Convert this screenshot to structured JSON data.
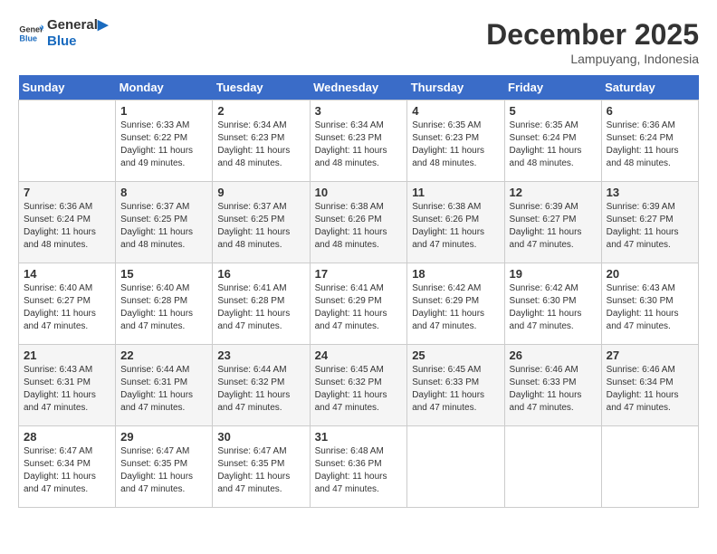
{
  "header": {
    "logo_line1": "General",
    "logo_line2": "Blue",
    "month": "December 2025",
    "location": "Lampuyang, Indonesia"
  },
  "days_of_week": [
    "Sunday",
    "Monday",
    "Tuesday",
    "Wednesday",
    "Thursday",
    "Friday",
    "Saturday"
  ],
  "weeks": [
    [
      {
        "day": "",
        "info": ""
      },
      {
        "day": "1",
        "info": "Sunrise: 6:33 AM\nSunset: 6:22 PM\nDaylight: 11 hours\nand 49 minutes."
      },
      {
        "day": "2",
        "info": "Sunrise: 6:34 AM\nSunset: 6:23 PM\nDaylight: 11 hours\nand 48 minutes."
      },
      {
        "day": "3",
        "info": "Sunrise: 6:34 AM\nSunset: 6:23 PM\nDaylight: 11 hours\nand 48 minutes."
      },
      {
        "day": "4",
        "info": "Sunrise: 6:35 AM\nSunset: 6:23 PM\nDaylight: 11 hours\nand 48 minutes."
      },
      {
        "day": "5",
        "info": "Sunrise: 6:35 AM\nSunset: 6:24 PM\nDaylight: 11 hours\nand 48 minutes."
      },
      {
        "day": "6",
        "info": "Sunrise: 6:36 AM\nSunset: 6:24 PM\nDaylight: 11 hours\nand 48 minutes."
      }
    ],
    [
      {
        "day": "7",
        "info": "Sunrise: 6:36 AM\nSunset: 6:24 PM\nDaylight: 11 hours\nand 48 minutes."
      },
      {
        "day": "8",
        "info": "Sunrise: 6:37 AM\nSunset: 6:25 PM\nDaylight: 11 hours\nand 48 minutes."
      },
      {
        "day": "9",
        "info": "Sunrise: 6:37 AM\nSunset: 6:25 PM\nDaylight: 11 hours\nand 48 minutes."
      },
      {
        "day": "10",
        "info": "Sunrise: 6:38 AM\nSunset: 6:26 PM\nDaylight: 11 hours\nand 48 minutes."
      },
      {
        "day": "11",
        "info": "Sunrise: 6:38 AM\nSunset: 6:26 PM\nDaylight: 11 hours\nand 47 minutes."
      },
      {
        "day": "12",
        "info": "Sunrise: 6:39 AM\nSunset: 6:27 PM\nDaylight: 11 hours\nand 47 minutes."
      },
      {
        "day": "13",
        "info": "Sunrise: 6:39 AM\nSunset: 6:27 PM\nDaylight: 11 hours\nand 47 minutes."
      }
    ],
    [
      {
        "day": "14",
        "info": "Sunrise: 6:40 AM\nSunset: 6:27 PM\nDaylight: 11 hours\nand 47 minutes."
      },
      {
        "day": "15",
        "info": "Sunrise: 6:40 AM\nSunset: 6:28 PM\nDaylight: 11 hours\nand 47 minutes."
      },
      {
        "day": "16",
        "info": "Sunrise: 6:41 AM\nSunset: 6:28 PM\nDaylight: 11 hours\nand 47 minutes."
      },
      {
        "day": "17",
        "info": "Sunrise: 6:41 AM\nSunset: 6:29 PM\nDaylight: 11 hours\nand 47 minutes."
      },
      {
        "day": "18",
        "info": "Sunrise: 6:42 AM\nSunset: 6:29 PM\nDaylight: 11 hours\nand 47 minutes."
      },
      {
        "day": "19",
        "info": "Sunrise: 6:42 AM\nSunset: 6:30 PM\nDaylight: 11 hours\nand 47 minutes."
      },
      {
        "day": "20",
        "info": "Sunrise: 6:43 AM\nSunset: 6:30 PM\nDaylight: 11 hours\nand 47 minutes."
      }
    ],
    [
      {
        "day": "21",
        "info": "Sunrise: 6:43 AM\nSunset: 6:31 PM\nDaylight: 11 hours\nand 47 minutes."
      },
      {
        "day": "22",
        "info": "Sunrise: 6:44 AM\nSunset: 6:31 PM\nDaylight: 11 hours\nand 47 minutes."
      },
      {
        "day": "23",
        "info": "Sunrise: 6:44 AM\nSunset: 6:32 PM\nDaylight: 11 hours\nand 47 minutes."
      },
      {
        "day": "24",
        "info": "Sunrise: 6:45 AM\nSunset: 6:32 PM\nDaylight: 11 hours\nand 47 minutes."
      },
      {
        "day": "25",
        "info": "Sunrise: 6:45 AM\nSunset: 6:33 PM\nDaylight: 11 hours\nand 47 minutes."
      },
      {
        "day": "26",
        "info": "Sunrise: 6:46 AM\nSunset: 6:33 PM\nDaylight: 11 hours\nand 47 minutes."
      },
      {
        "day": "27",
        "info": "Sunrise: 6:46 AM\nSunset: 6:34 PM\nDaylight: 11 hours\nand 47 minutes."
      }
    ],
    [
      {
        "day": "28",
        "info": "Sunrise: 6:47 AM\nSunset: 6:34 PM\nDaylight: 11 hours\nand 47 minutes."
      },
      {
        "day": "29",
        "info": "Sunrise: 6:47 AM\nSunset: 6:35 PM\nDaylight: 11 hours\nand 47 minutes."
      },
      {
        "day": "30",
        "info": "Sunrise: 6:47 AM\nSunset: 6:35 PM\nDaylight: 11 hours\nand 47 minutes."
      },
      {
        "day": "31",
        "info": "Sunrise: 6:48 AM\nSunset: 6:36 PM\nDaylight: 11 hours\nand 47 minutes."
      },
      {
        "day": "",
        "info": ""
      },
      {
        "day": "",
        "info": ""
      },
      {
        "day": "",
        "info": ""
      }
    ]
  ]
}
